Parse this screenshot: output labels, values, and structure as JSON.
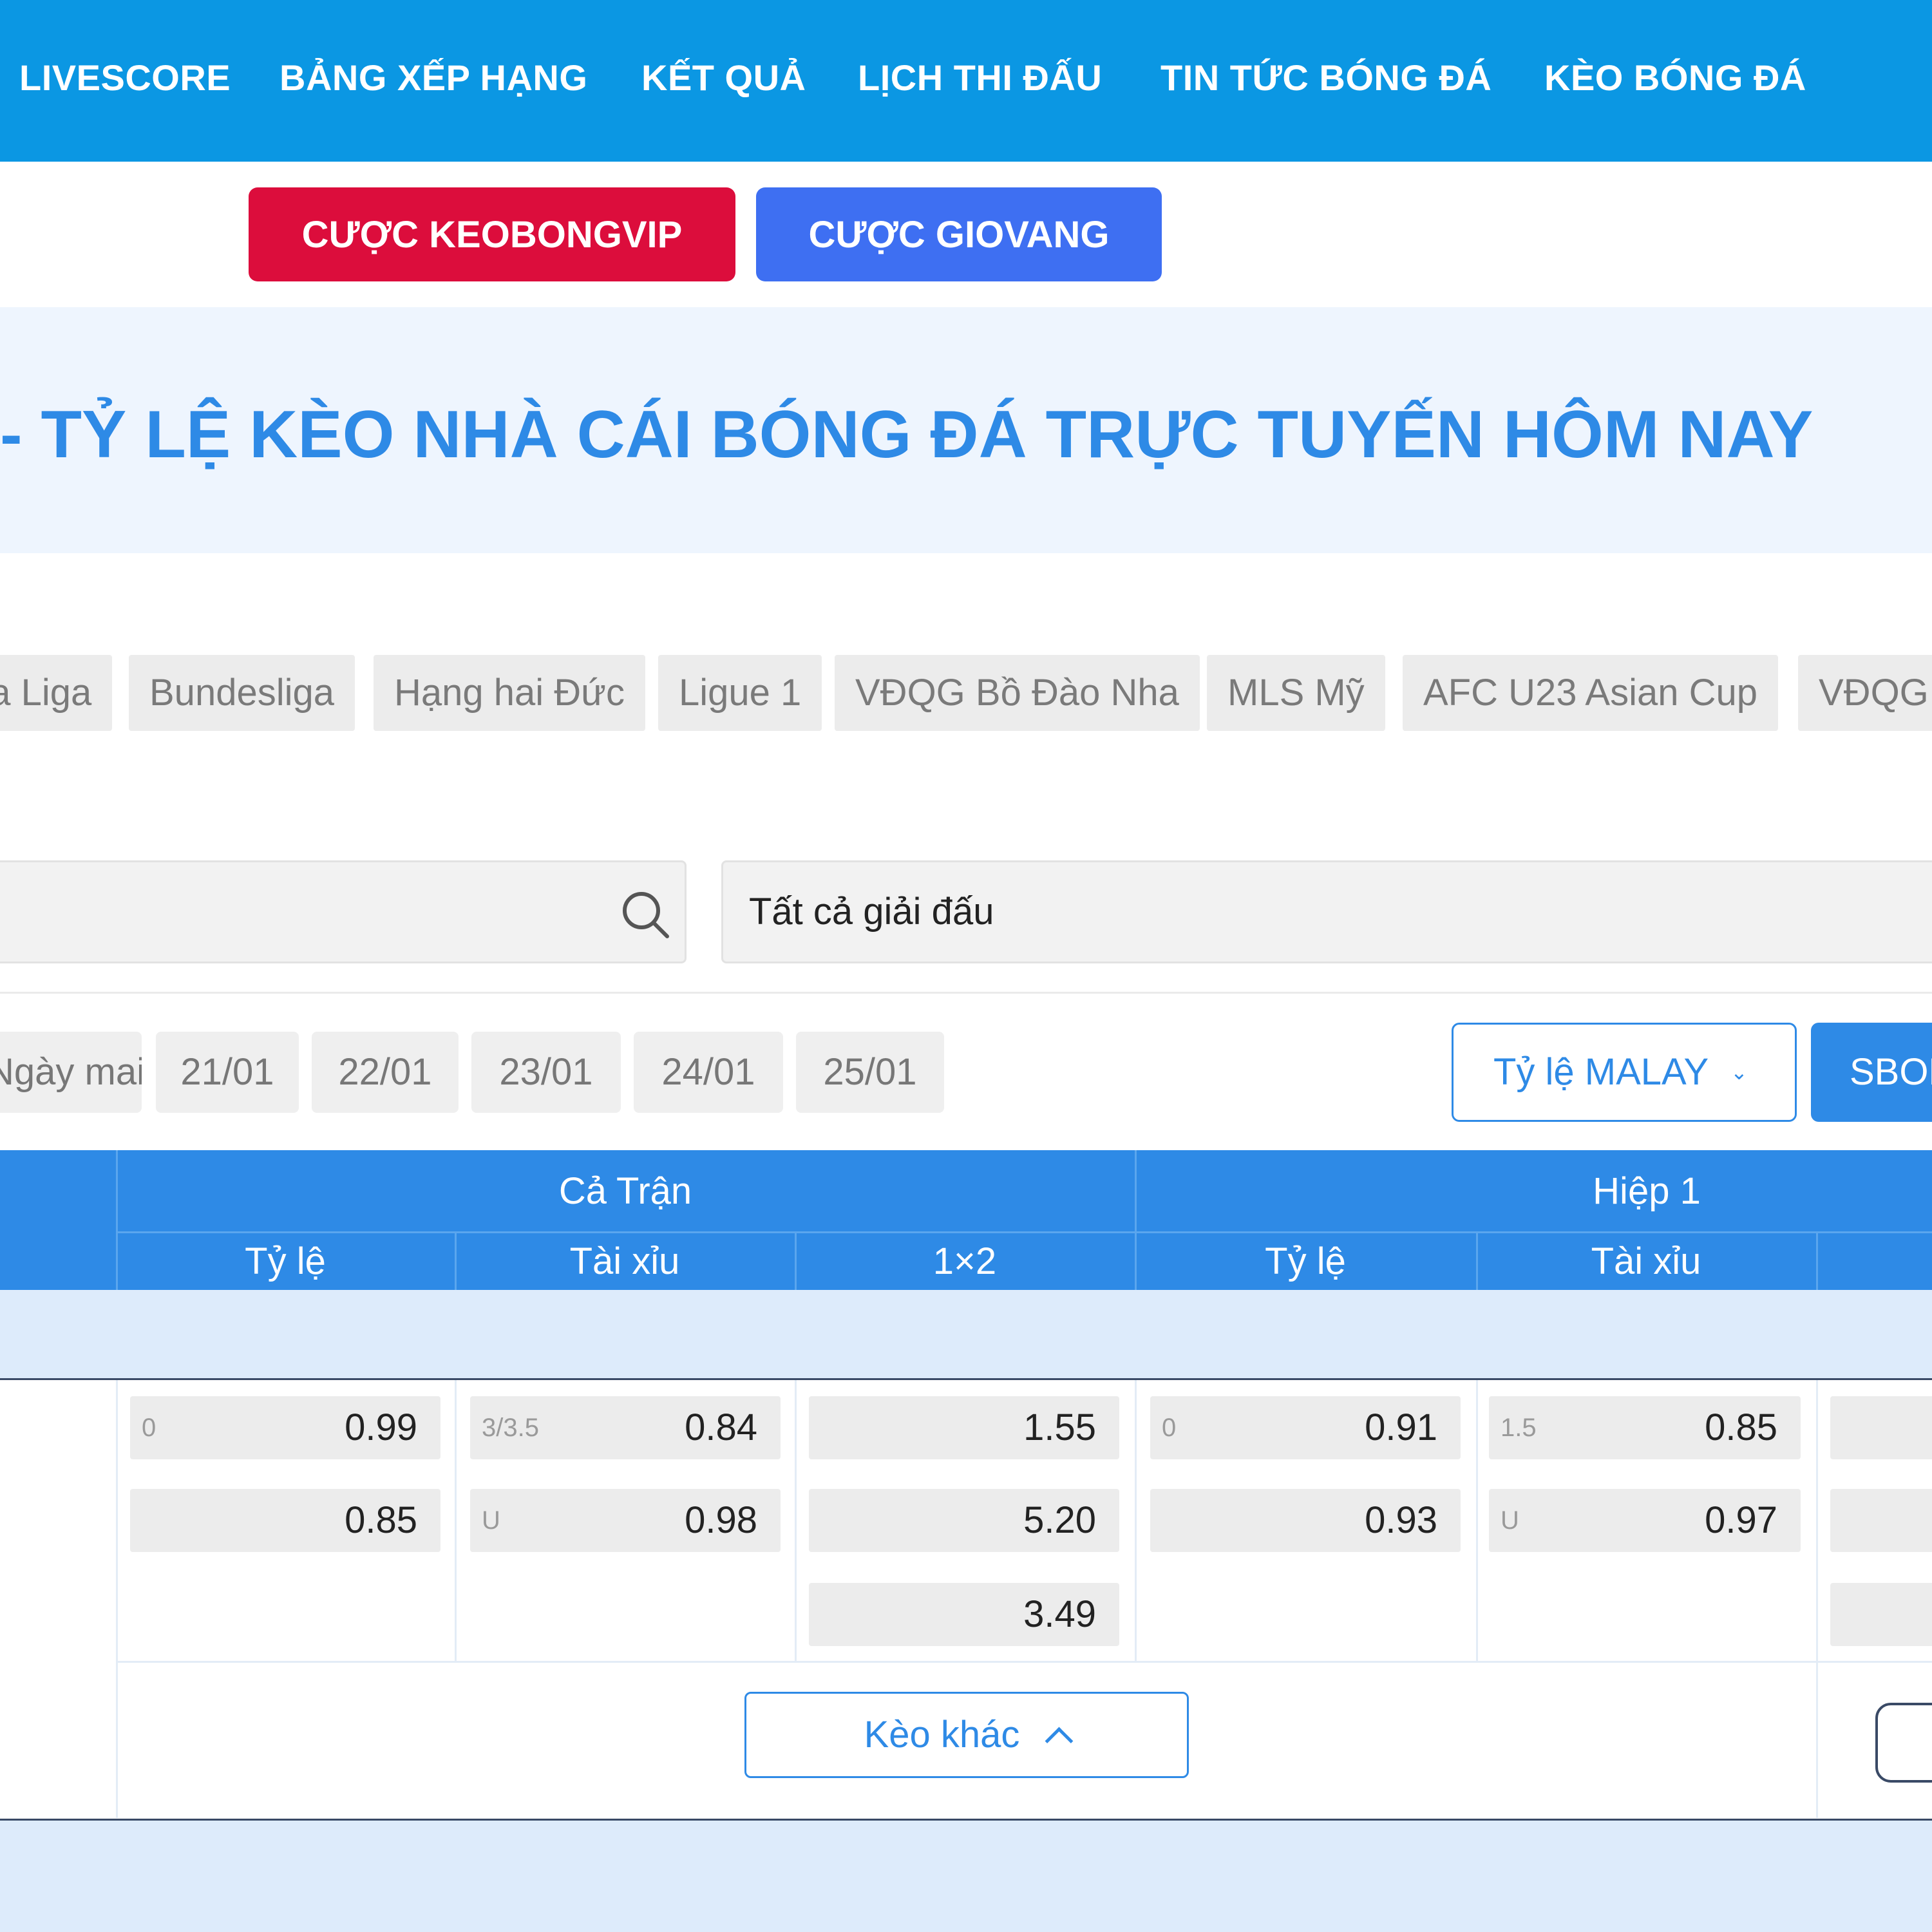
{
  "nav": {
    "items": [
      "LIVESCORE",
      "BẢNG XẾP HẠNG",
      "KẾT QUẢ",
      "LỊCH THI ĐẤU",
      "TIN TỨC BÓNG ĐÁ",
      "KÈO BÓNG ĐÁ"
    ]
  },
  "bet_buttons": {
    "keobongvip": "CƯỢC KEOBONGVIP",
    "giovang": "CƯỢC GIOVANG",
    "keobongvip_color": "#dc0d3c",
    "giovang_color": "#3e6ff2"
  },
  "page_title": "- TỶ LỆ KÈO NHÀ CÁI BÓNG ĐÁ TRỰC TUYẾN HÔM NAY",
  "league_tabs": [
    "La Liga",
    "Bundesliga",
    "Hạng hai Đức",
    "Ligue 1",
    "VĐQG Bồ Đào Nha",
    "MLS Mỹ",
    "AFC U23 Asian Cup",
    "VĐQG"
  ],
  "search": {
    "icon": "search-icon"
  },
  "league_filter": {
    "selected": "Tất cả giải đấu"
  },
  "dates": [
    "Ngày mai",
    "21/01",
    "22/01",
    "23/01",
    "24/01",
    "25/01"
  ],
  "odds_type": {
    "label": "Tỷ lệ MALAY",
    "icon": "chevron-down-icon"
  },
  "bookmaker": {
    "label": "SBOBET"
  },
  "table": {
    "groups": {
      "full_match": "Cả Trận",
      "first_half": "Hiệp 1"
    },
    "columns": {
      "handicap": "Tỷ lệ",
      "over_under": "Tài xỉu",
      "one_x_two": "1×2",
      "h1_handicap": "Tỷ lệ",
      "h1_over_under": "Tài xỉu"
    },
    "match": {
      "handicap": {
        "line": "0",
        "home": "0.99",
        "away": "0.85"
      },
      "over_under": {
        "line": "3/3.5",
        "over": "0.84",
        "under_label": "U",
        "under": "0.98"
      },
      "one_x_two": {
        "home": "1.55",
        "away": "5.20",
        "draw": "3.49"
      },
      "h1_handicap": {
        "line": "0",
        "home": "0.91",
        "away": "0.93"
      },
      "h1_over_under": {
        "line": "1.5",
        "over": "0.85",
        "under_label": "U",
        "under": "0.97"
      }
    },
    "more_button": "Kèo khác"
  },
  "colors": {
    "nav_bg": "#0b97e3",
    "accent": "#2e8ae6",
    "title_band": "#eef5fe",
    "league_band": "#ddebfb"
  }
}
